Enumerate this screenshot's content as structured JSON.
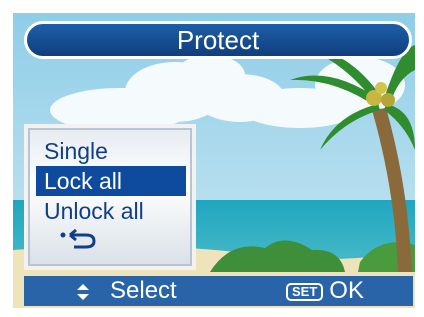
{
  "header": {
    "title": "Protect"
  },
  "menu": {
    "items": [
      {
        "label": "Single",
        "selected": false
      },
      {
        "label": "Lock all",
        "selected": true
      },
      {
        "label": "Unlock all",
        "selected": false
      }
    ],
    "back_icon": "return-icon"
  },
  "footer": {
    "select_label": "Select",
    "set_badge": "SET",
    "ok_label": "OK"
  },
  "colors": {
    "title_bg": "#1e5fa8",
    "footer_bg": "#2a64a8",
    "menu_highlight": "#0e4a9e",
    "menu_text": "#103f86"
  }
}
